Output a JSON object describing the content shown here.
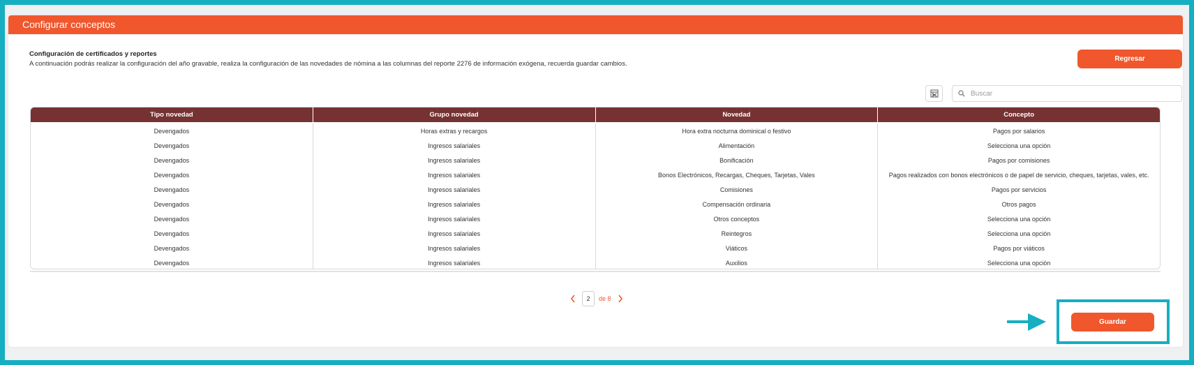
{
  "header": {
    "title": "Configurar conceptos"
  },
  "section": {
    "title": "Configuración de certificados y reportes",
    "description": "A continuación podrás realizar la configuración del año gravable, realiza la configuración de las novedades de nómina a las columnas del reporte 2276 de información exógena, recuerda guardar cambios."
  },
  "buttons": {
    "back_label": "Regresar",
    "save_label": "Guardar"
  },
  "search": {
    "placeholder": "Buscar"
  },
  "table": {
    "headers": [
      "Tipo novedad",
      "Grupo novedad",
      "Novedad",
      "Concepto"
    ],
    "rows": [
      [
        "Devengados",
        "Horas extras y recargos",
        "Hora extra nocturna dominical o festivo",
        "Pagos por salarios"
      ],
      [
        "Devengados",
        "Ingresos salariales",
        "Alimentación",
        "Selecciona una opción"
      ],
      [
        "Devengados",
        "Ingresos salariales",
        "Bonificación",
        "Pagos por comisiones"
      ],
      [
        "Devengados",
        "Ingresos salariales",
        "Bonos Electrónicos, Recargas, Cheques, Tarjetas, Vales",
        "Pagos realizados con bonos electrónicos o de papel de servicio, cheques, tarjetas, vales, etc."
      ],
      [
        "Devengados",
        "Ingresos salariales",
        "Comisiones",
        "Pagos por servicios"
      ],
      [
        "Devengados",
        "Ingresos salariales",
        "Compensación ordinaria",
        "Otros pagos"
      ],
      [
        "Devengados",
        "Ingresos salariales",
        "Otros conceptos",
        "Selecciona una opción"
      ],
      [
        "Devengados",
        "Ingresos salariales",
        "Reintegros",
        "Selecciona una opción"
      ],
      [
        "Devengados",
        "Ingresos salariales",
        "Viáticos",
        "Pagos por viáticos"
      ],
      [
        "Devengados",
        "Ingresos salariales",
        "Auxilios",
        "Selecciona una opción"
      ]
    ]
  },
  "pagination": {
    "current_page": "2",
    "of_text": "de 8"
  },
  "colors": {
    "accent": "#f0572d",
    "table_header": "#763232",
    "annotation": "#16aec1"
  },
  "icons": {
    "export": "excel-export-icon",
    "search": "search-icon",
    "prev": "chevron-left-icon",
    "next": "chevron-right-icon",
    "annotation_arrow": "arrow-right-icon"
  }
}
